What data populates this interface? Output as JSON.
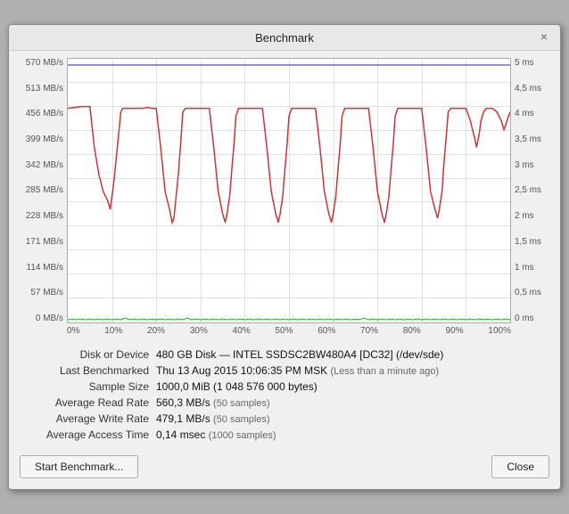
{
  "window": {
    "title": "Benchmark",
    "close_label": "×"
  },
  "chart": {
    "y_left_labels": [
      "0 MB/s",
      "57 MB/s",
      "114 MB/s",
      "171 MB/s",
      "228 MB/s",
      "285 MB/s",
      "342 MB/s",
      "399 MB/s",
      "456 MB/s",
      "513 MB/s",
      "570 MB/s"
    ],
    "y_right_labels": [
      "0 ms",
      "0,5 ms",
      "1 ms",
      "1,5 ms",
      "2 ms",
      "2,5 ms",
      "3 ms",
      "3,5 ms",
      "4 ms",
      "4,5 ms",
      "5 ms"
    ],
    "x_labels": [
      "0%",
      "10%",
      "20%",
      "30%",
      "40%",
      "50%",
      "60%",
      "70%",
      "80%",
      "90%",
      "100%"
    ]
  },
  "info": {
    "disk_label": "Disk or Device",
    "disk_value": "480 GB Disk — INTEL SSDSC2BW480A4 [DC32] (/dev/sde)",
    "benchmarked_label": "Last Benchmarked",
    "benchmarked_value": "Thu 13 Aug 2015 10:06:35 PM MSK",
    "benchmarked_muted": "(Less than a minute ago)",
    "sample_label": "Sample Size",
    "sample_value": "1000,0 MiB (1 048 576 000 bytes)",
    "read_rate_label": "Average Read Rate",
    "read_rate_value": "560,3 MB/s",
    "read_rate_muted": "(50 samples)",
    "write_rate_label": "Average Write Rate",
    "write_rate_value": "479,1 MB/s",
    "write_rate_muted": "(50 samples)",
    "access_label": "Average Access Time",
    "access_value": "0,14 msec",
    "access_muted": "(1000 samples)"
  },
  "buttons": {
    "start_label": "Start Benchmark...",
    "close_label": "Close"
  }
}
